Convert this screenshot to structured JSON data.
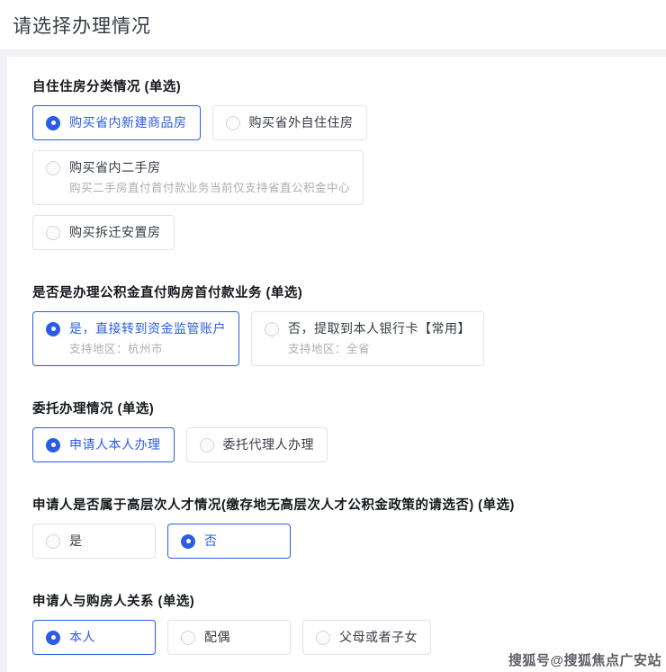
{
  "page_title": "请选择办理情况",
  "watermark": "搜狐号@搜狐焦点广安站",
  "colors": {
    "accent_blue": "#2b5ce6",
    "box_border_gray": "#e1e3e8",
    "subtitle_gray": "#aaadb4",
    "page_band_gray": "#f1f2f6"
  },
  "sections": [
    {
      "label": "自住住房分类情况 (单选)",
      "options": [
        {
          "label": "购买省内新建商品房",
          "selected": true
        },
        {
          "label": "购买省外自住住房",
          "selected": false
        },
        {
          "label": "购买省内二手房",
          "subtitle": "购买二手房直付首付款业务当前仅支持省直公积金中心",
          "selected": false
        },
        {
          "label": "购买拆迁安置房",
          "selected": false
        }
      ]
    },
    {
      "label": "是否是办理公积金直付购房首付款业务 (单选)",
      "options": [
        {
          "label": "是，直接转到资金监管账户",
          "subtitle": "支持地区：杭州市",
          "selected": true
        },
        {
          "label": "否，提取到本人银行卡【常用】",
          "subtitle": "支持地区：全省",
          "selected": false
        }
      ]
    },
    {
      "label": "委托办理情况 (单选)",
      "options": [
        {
          "label": "申请人本人办理",
          "selected": true
        },
        {
          "label": "委托代理人办理",
          "selected": false
        }
      ]
    },
    {
      "label": "申请人是否属于高层次人才情况(缴存地无高层次人才公积金政策的请选否) (单选)",
      "options": [
        {
          "label": "是",
          "selected": false
        },
        {
          "label": "否",
          "selected": true
        }
      ]
    },
    {
      "label": "申请人与购房人关系 (单选)",
      "options": [
        {
          "label": "本人",
          "selected": true
        },
        {
          "label": "配偶",
          "selected": false
        },
        {
          "label": "父母或者子女",
          "selected": false
        }
      ]
    }
  ]
}
